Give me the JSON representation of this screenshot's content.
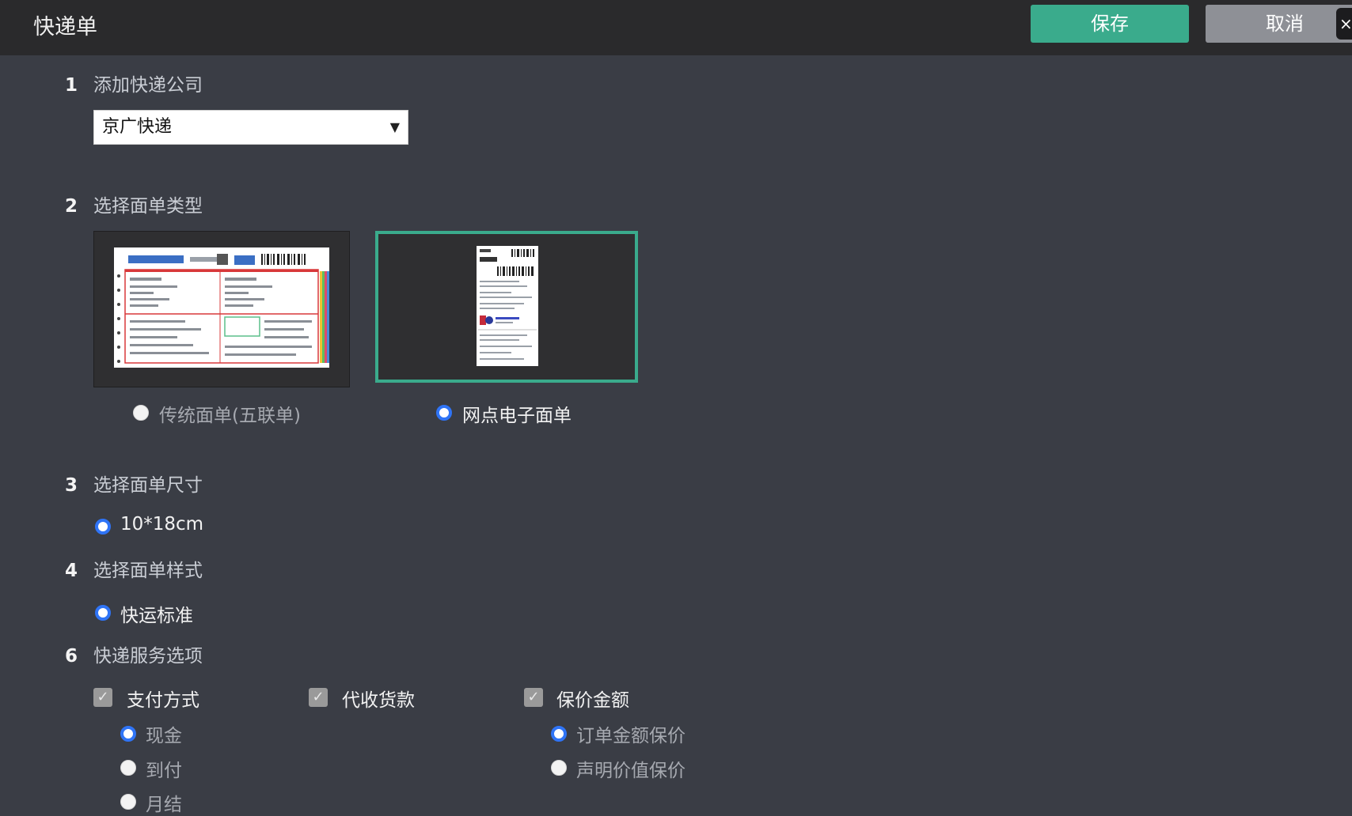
{
  "header": {
    "title": "快递单",
    "save_label": "保存",
    "cancel_label": "取消",
    "close_glyph": "×"
  },
  "sections": {
    "s1": {
      "num": "1",
      "title": "添加快递公司"
    },
    "s2": {
      "num": "2",
      "title": "选择面单类型"
    },
    "s3": {
      "num": "3",
      "title": "选择面单尺寸"
    },
    "s4": {
      "num": "4",
      "title": "选择面单样式"
    },
    "s6": {
      "num": "6",
      "title": "快递服务选项"
    }
  },
  "company_select": {
    "value": "京广快递",
    "arrow": "▼"
  },
  "sheet_types": {
    "traditional": {
      "label": "传统面单(五联单)",
      "selected": false
    },
    "network": {
      "label": "网点电子面单",
      "selected": true
    }
  },
  "size": {
    "label": "10*18cm",
    "selected": true
  },
  "style": {
    "label": "快运标准",
    "selected": true
  },
  "services": {
    "payment": {
      "label": "支付方式",
      "checked": true,
      "options": [
        {
          "label": "现金",
          "selected": true
        },
        {
          "label": "到付",
          "selected": false
        },
        {
          "label": "月结",
          "selected": false
        }
      ]
    },
    "cod": {
      "label": "代收货款",
      "checked": true
    },
    "insurance": {
      "label": "保价金额",
      "checked": true,
      "options": [
        {
          "label": "订单金额保价",
          "selected": true
        },
        {
          "label": "声明价值保价",
          "selected": false
        }
      ]
    }
  },
  "check_glyph": "✓",
  "colors": {
    "accent": "#3aab8c",
    "radio_selected": "#2f74f6",
    "panel_bg": "#3a3d45",
    "header_bg": "#2a2a2c"
  }
}
